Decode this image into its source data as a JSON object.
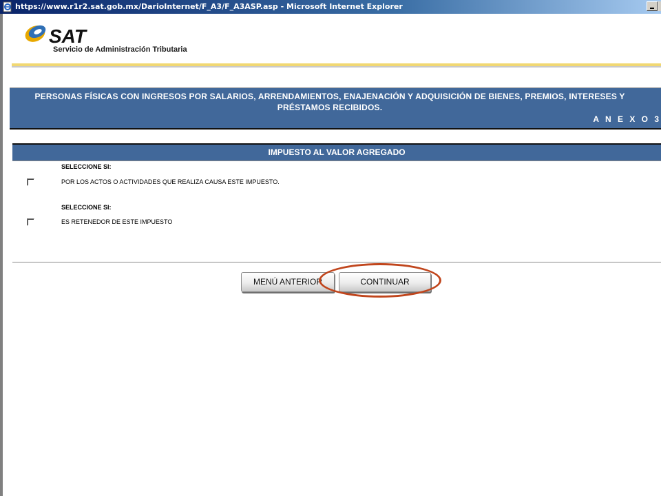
{
  "window": {
    "title": "https://www.r1r2.sat.gob.mx/DarioInternet/F_A3/F_A3ASP.asp - Microsoft Internet Explorer",
    "icon": "ie-page-icon"
  },
  "logo": {
    "mark": "SAT",
    "subtitle": "Servicio de Administración Tributaria"
  },
  "banner": {
    "title": "PERSONAS FÍSICAS CON INGRESOS POR SALARIOS, ARRENDAMIENTOS, ENAJENACIÓN Y ADQUISICIÓN DE BIENES, PREMIOS, INTERESES Y PRÉSTAMOS RECIBIDOS.",
    "annex": "A N E X O 3"
  },
  "section": {
    "header": "IMPUESTO AL VALOR AGREGADO",
    "options": [
      {
        "select_label": "SELECCIONE SI:",
        "text": "POR LOS ACTOS O ACTIVIDADES QUE REALIZA CAUSA ESTE IMPUESTO.",
        "checked": false
      },
      {
        "select_label": "SELECCIONE SI:",
        "text": "ES RETENEDOR DE ESTE IMPUESTO",
        "checked": false
      }
    ]
  },
  "buttons": {
    "previous_menu": "MENÚ ANTERIOR",
    "continue": "CONTINUAR"
  },
  "colors": {
    "banner": "#41689a",
    "gold_rule": "#f1d873",
    "highlight": "#c0451c"
  }
}
